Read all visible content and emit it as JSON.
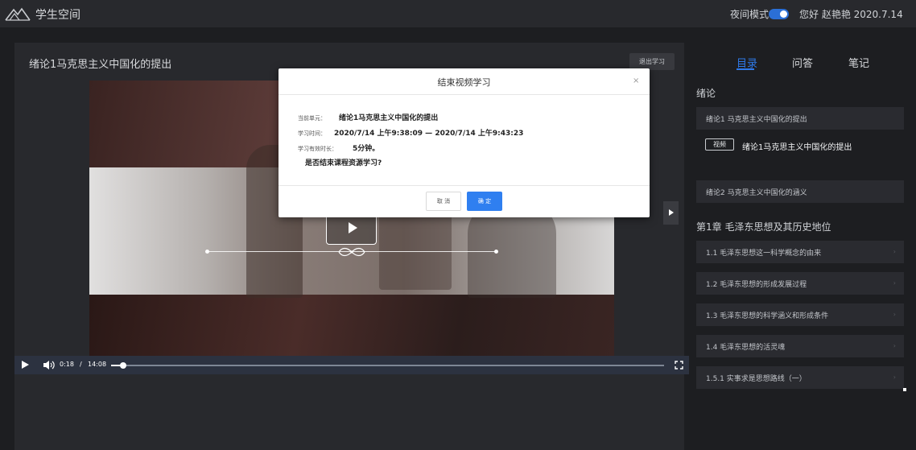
{
  "header": {
    "app_title": "学生空间",
    "night_mode_label": "夜间模式",
    "night_mode_on": true,
    "greeting": "您好 赵艳艳 2020.7.14"
  },
  "lesson": {
    "title": "绪论1马克思主义中国化的提出",
    "exit_label": "退出学习"
  },
  "player": {
    "current_time": "0:18",
    "separator": "/",
    "duration": "14:08",
    "progress_fraction": 0.021
  },
  "sidebar": {
    "tabs": [
      {
        "label": "目录",
        "active": true
      },
      {
        "label": "问答",
        "active": false
      },
      {
        "label": "笔记",
        "active": false
      }
    ],
    "section1_title": "绪论",
    "section1_items": [
      {
        "label": "绪论1 马克思主义中国化的提出"
      }
    ],
    "video_badge": "视频",
    "video_title": "绪论1马克思主义中国化的提出",
    "section1_items2": [
      {
        "label": "绪论2 马克思主义中国化的涵义"
      }
    ],
    "section2_title": "第1章 毛泽东思想及其历史地位",
    "section2_items": [
      {
        "label": "1.1 毛泽东思想这一科学概念的由来"
      },
      {
        "label": "1.2 毛泽东思想的形成发展过程"
      },
      {
        "label": "1.3 毛泽东思想的科学涵义和形成条件"
      },
      {
        "label": "1.4 毛泽东思想的活灵魂"
      },
      {
        "label": "1.5.1 实事求是思想路线（一）"
      }
    ]
  },
  "modal": {
    "title": "结束视频学习",
    "close_symbol": "×",
    "unit_label": "当前单元：",
    "unit_value": "绪论1马克思主义中国化的提出",
    "time_label": "学习时间：",
    "time_value": "2020/7/14 上午9:38:09 — 2020/7/14 上午9:43:23",
    "duration_label": "学习有效时长：",
    "duration_value": "5分钟。",
    "question": "是否结束课程资源学习?",
    "cancel_label": "取 消",
    "ok_label": "确 定"
  }
}
